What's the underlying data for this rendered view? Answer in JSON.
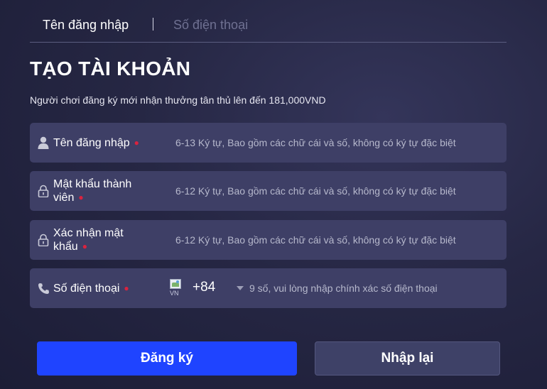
{
  "tabs": {
    "username": "Tên đăng nhập",
    "phone": "Số điện thoại"
  },
  "title": "TẠO TÀI KHOẢN",
  "subtitle": "Người chơi đăng ký mới nhận thưởng tân thủ lên đến 181,000VND",
  "required_mark": "●",
  "fields": {
    "username": {
      "label": "Tên đăng nhập",
      "hint": "6-13 Ký tự, Bao gồm các chữ cái và số, không có ký tự đặc biệt",
      "icon": "user-icon"
    },
    "password": {
      "label": "Mật khẩu thành viên",
      "hint": "6-12 Ký tự, Bao gồm các chữ cái và số, không có ký tự đặc biệt",
      "icon": "lock-icon"
    },
    "confirm": {
      "label": "Xác nhận mật khẩu",
      "hint": "6-12 Ký tự, Bao gồm các chữ cái và số, không có ký tự đặc biệt",
      "icon": "lock-icon"
    },
    "phone": {
      "label": "Số điện thoại",
      "flag_alt": "VN",
      "country_code": "+84",
      "hint": "9 số, vui lòng nhập chính xác số điện thoại",
      "icon": "phone-icon"
    }
  },
  "buttons": {
    "register": "Đăng ký",
    "reset": "Nhập lại"
  },
  "colors": {
    "primary": "#1f44ff",
    "field_bg": "#3e3f66",
    "required": "#d9233f"
  }
}
